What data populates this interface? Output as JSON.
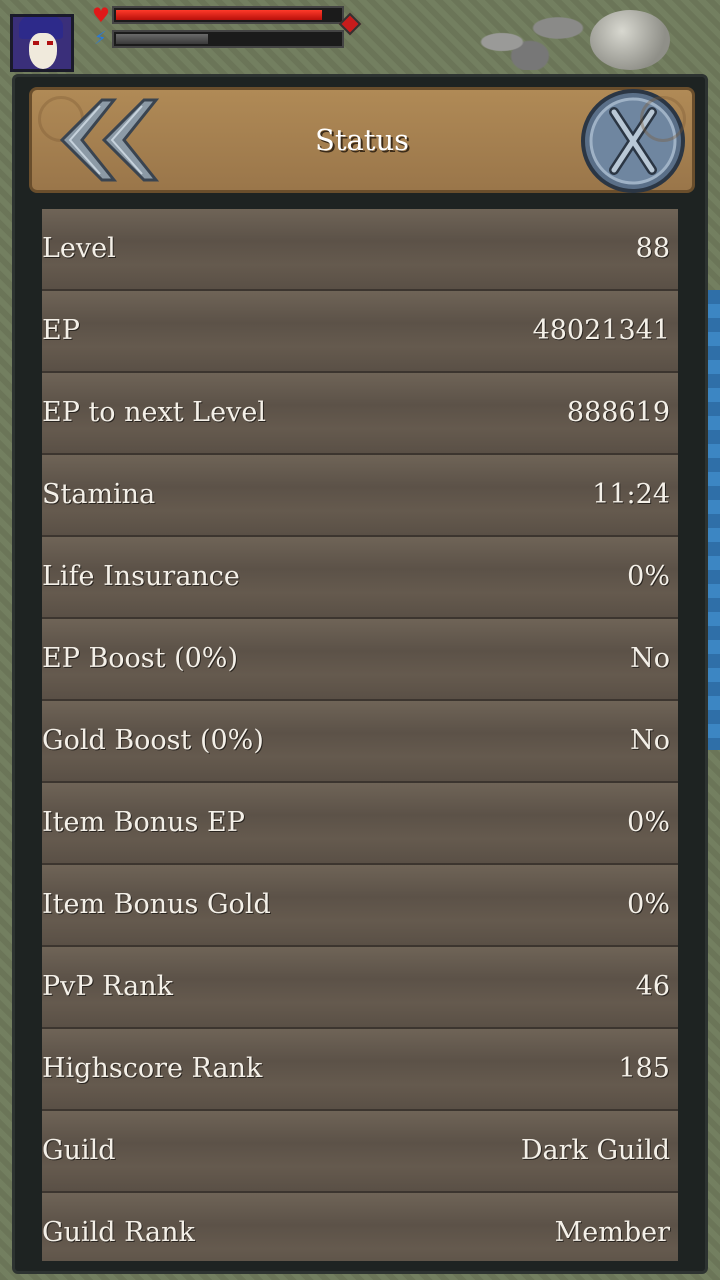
{
  "hud": {
    "hp_fraction": 0.92,
    "ep_fraction": 0.41
  },
  "panel": {
    "title": "Status"
  },
  "stats": [
    {
      "label": "Level",
      "value": "88"
    },
    {
      "label": "EP",
      "value": "48021341"
    },
    {
      "label": "EP to next Level",
      "value": "888619"
    },
    {
      "label": "Stamina",
      "value": "11:24"
    },
    {
      "label": "Life Insurance",
      "value": "0%"
    },
    {
      "label": "EP Boost (0%)",
      "value": "No"
    },
    {
      "label": "Gold Boost (0%)",
      "value": "No"
    },
    {
      "label": "Item Bonus EP",
      "value": "0%"
    },
    {
      "label": "Item Bonus Gold",
      "value": "0%"
    },
    {
      "label": "PvP Rank",
      "value": "46"
    },
    {
      "label": "Highscore Rank",
      "value": "185"
    },
    {
      "label": "Guild",
      "value": "Dark Guild"
    },
    {
      "label": "Guild Rank",
      "value": "Member"
    }
  ],
  "colors": {
    "header_bg": "#a8824f",
    "row_bg": "#5e544a",
    "hp": "#e02a1a",
    "scrollbar": "#a07a2a"
  }
}
